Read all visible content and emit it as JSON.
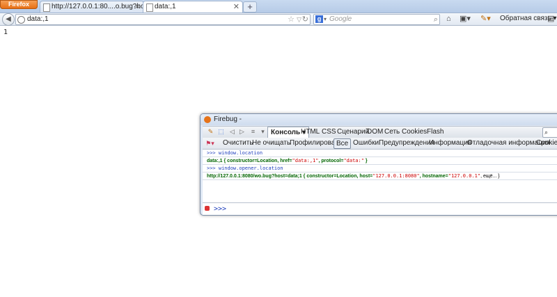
{
  "browser": {
    "app_button": "Firefox",
    "tabs": [
      {
        "title": "http://127.0.0.1:80....o.bug?host=data;1"
      },
      {
        "title": "data:,1"
      }
    ],
    "url": "data:,1",
    "search_engine": "Google",
    "feedback": "Обратная связь"
  },
  "page": {
    "text": "1"
  },
  "firebug": {
    "title": "Firebug -",
    "console_tab": "Консоль",
    "panel_tabs": [
      "HTML",
      "CSS",
      "Сценарий",
      "DOM",
      "Сеть",
      "Cookies",
      "Flash"
    ],
    "toolbar": {
      "clear": "Очистить",
      "persist": "Не очищать",
      "profile": "Профилировать",
      "all": "Все",
      "errors": "Ошибки",
      "warnings": "Предупреждения",
      "info": "Информация",
      "debug": "Отладочная информация",
      "cookies": "Cookies"
    },
    "log": [
      {
        "type": "cmd",
        "text": ">>> window.location"
      },
      {
        "type": "res",
        "pre": "data:,1 { constructor=Location, href=",
        "s1": "\"data:,1\"",
        "mid": ", protocol=",
        "s2": "\"data:\"",
        "post": " }"
      },
      {
        "type": "cmd",
        "text": ">>> window.opener.location"
      },
      {
        "type": "res",
        "pre": "http://127.0.0.1:8080/wo.bug?host=data;1 { constructor=Location, host=",
        "s1": "\"127.0.0.1:8080\"",
        "mid": ", hostname=",
        "s2": "\"127.0.0.1\"",
        "more": ", ещё... }"
      }
    ],
    "prompt": ">>>"
  }
}
